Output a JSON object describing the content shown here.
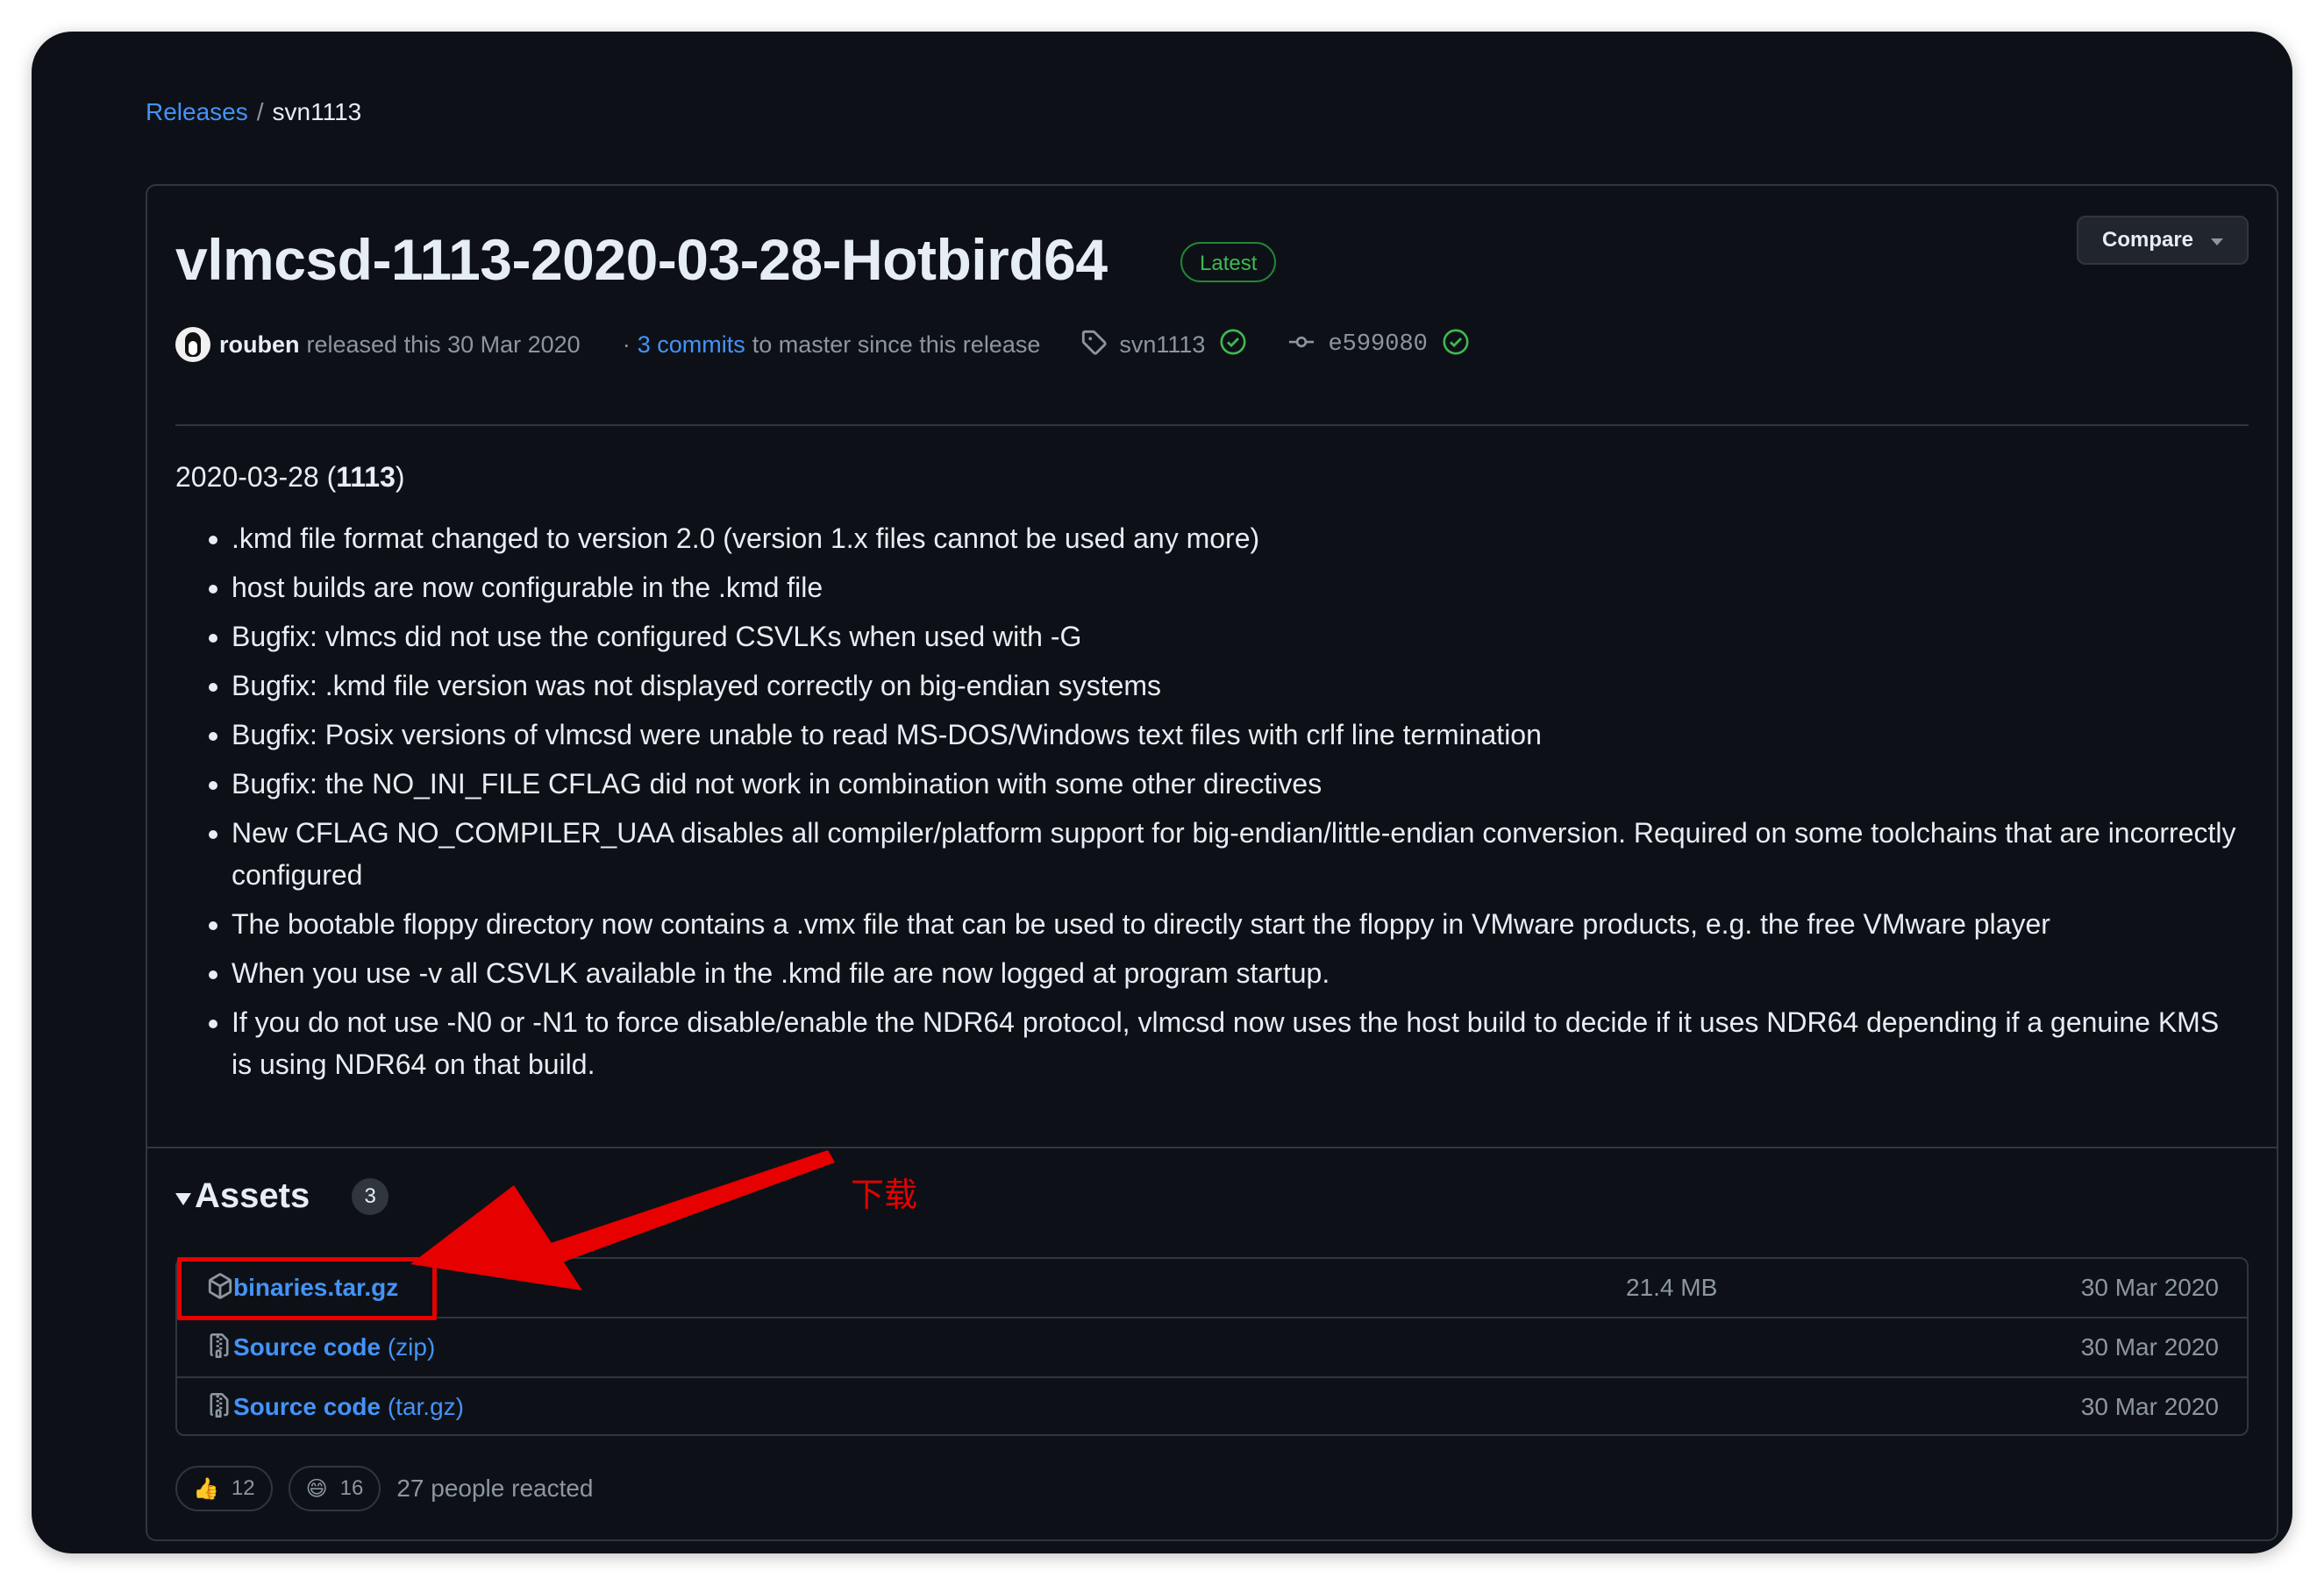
{
  "breadcrumb": {
    "releases": "Releases",
    "separator": "/",
    "current": "svn1113"
  },
  "release": {
    "title": "vlmcsd-1113-2020-03-28-Hotbird64",
    "badge": "Latest",
    "compare_label": "Compare",
    "author": "rouben",
    "released_text": "released this 30 Mar 2020",
    "dot": "·",
    "commits_link": "3 commits",
    "commits_rest": "to master since this release",
    "tag": "svn1113",
    "commit_hash": "e599080"
  },
  "notes": {
    "date_prefix": "2020-03-28 (",
    "date_bold": "1113",
    "date_suffix": ")",
    "items": [
      ".kmd file format changed to version 2.0 (version 1.x files cannot be used any more)",
      "host builds are now configurable in the .kmd file",
      "Bugfix: vlmcs did not use the configured CSVLKs when used with -G",
      "Bugfix: .kmd file version was not displayed correctly on big-endian systems",
      "Bugfix: Posix versions of vlmcsd were unable to read MS-DOS/Windows text files with crlf line termination",
      "Bugfix: the NO_INI_FILE CFLAG did not work in combination with some other directives",
      "New CFLAG NO_COMPILER_UAA disables all compiler/platform support for big-endian/little-endian conversion. Required on some toolchains that are incorrectly configured",
      "The bootable floppy directory now contains a .vmx file that can be used to directly start the floppy in VMware products, e.g. the free VMware player",
      "When you use -v all CSVLK available in the .kmd file are now logged at program startup.",
      "If you do not use -N0 or -N1 to force disable/enable the NDR64 protocol, vlmcsd now uses the host build to decide if it uses NDR64 depending if a genuine KMS is using NDR64 on that build."
    ]
  },
  "assets": {
    "heading": "Assets",
    "count": "3",
    "annotation": "下载",
    "rows": [
      {
        "name": "binaries.tar.gz",
        "sub": "",
        "size": "21.4 MB",
        "date": "30 Mar 2020",
        "icon": "package-icon"
      },
      {
        "name": "Source code",
        "sub": "(zip)",
        "size": "",
        "date": "30 Mar 2020",
        "icon": "file-zip-icon"
      },
      {
        "name": "Source code",
        "sub": "(tar.gz)",
        "size": "",
        "date": "30 Mar 2020",
        "icon": "file-zip-icon"
      }
    ]
  },
  "reactions": {
    "thumbs_up": {
      "emoji": "👍",
      "count": "12"
    },
    "smile": {
      "emoji": "😄",
      "count": "16"
    },
    "summary": "27 people reacted"
  },
  "colors": {
    "background": "#0d1117",
    "link": "#4493f8",
    "border": "#30363d",
    "success": "#3fb950",
    "annotation_red": "#e60000"
  }
}
